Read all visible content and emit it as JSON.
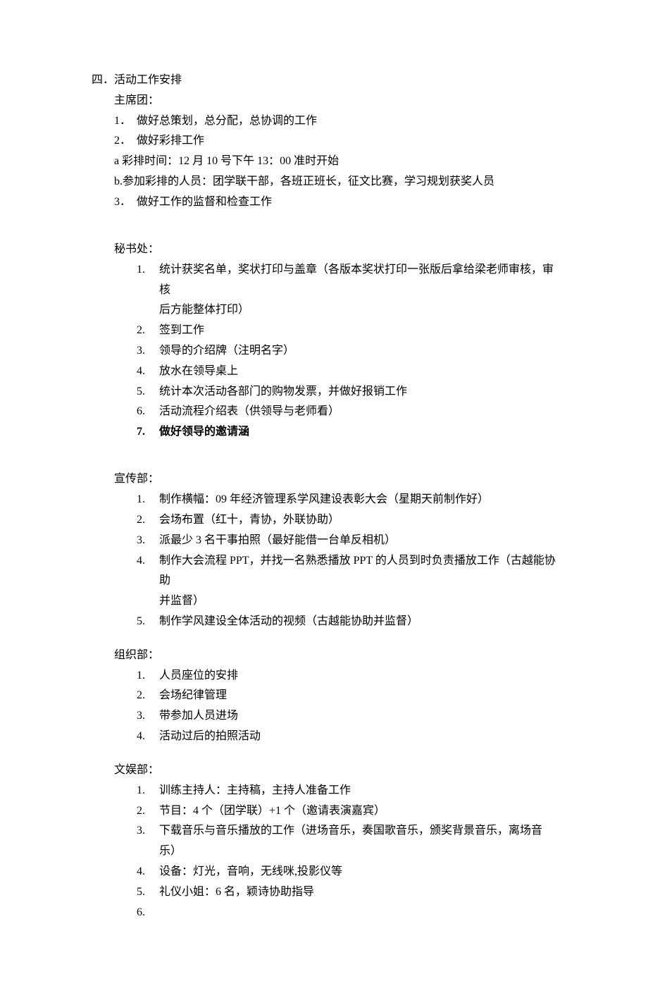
{
  "section4": {
    "title": "四．活动工作安排",
    "presidium": {
      "header": "主席团：",
      "item1_num": "1．",
      "item1": "做好总策划，总分配，总协调的工作",
      "item2_num": "2．",
      "item2": "做好彩排工作",
      "sub_a": "a 彩排时间：12 月 10 号下午 13：00 准时开始",
      "sub_b": "b.参加彩排的人员：团学联干部，各班正班长，征文比赛，学习规划获奖人员",
      "item3_num": "3．",
      "item3": "做好工作的监督和检查工作"
    },
    "secretariat": {
      "header": "秘书处：",
      "item1_num": "1.",
      "item1": "统计获奖名单，奖状打印与盖章（各版本奖状打印一张版后拿给梁老师审核，审核",
      "item1_cont": "后方能整体打印）",
      "item2_num": "2.",
      "item2": "签到工作",
      "item3_num": "3.",
      "item3": "领导的介绍牌（注明名字）",
      "item4_num": "4.",
      "item4": "放水在领导桌上",
      "item5_num": "5.",
      "item5": "统计本次活动各部门的购物发票，并做好报销工作",
      "item6_num": "6.",
      "item6": "活动流程介绍表（供领导与老师看）",
      "item7_num": "7.",
      "item7": "做好领导的邀请涵"
    },
    "publicity": {
      "header": "宣传部：",
      "item1_num": "1.",
      "item1": "制作横幅：09 年经济管理系学风建设表彰大会（星期天前制作好）",
      "item2_num": "2.",
      "item2": "会场布置（红十，青协，外联协助）",
      "item3_num": "3.",
      "item3": "派最少 3 名干事拍照（最好能借一台单反相机）",
      "item4_num": "4.",
      "item4": "制作大会流程 PPT，并找一名熟悉播放 PPT 的人员到时负责播放工作（古越能协助",
      "item4_cont": "并监督）",
      "item5_num": "5.",
      "item5": "制作学风建设全体活动的视频（古越能协助并监督）"
    },
    "organization": {
      "header": "组织部：",
      "item1_num": "1.",
      "item1": "人员座位的安排",
      "item2_num": "2.",
      "item2": "会场纪律管理",
      "item3_num": "3.",
      "item3": "带参加人员进场",
      "item4_num": "4.",
      "item4": "活动过后的拍照活动"
    },
    "entertainment": {
      "header": "文娱部：",
      "item1_num": "1.",
      "item1": "训练主持人：主持稿，主持人准备工作",
      "item2_num": "2.",
      "item2": "节目：4 个（团学联）+1 个（邀请表演嘉宾）",
      "item3_num": "3.",
      "item3": "下载音乐与音乐播放的工作（进场音乐，奏国歌音乐，颁奖背景音乐，离场音乐）",
      "item4_num": "4.",
      "item4": "设备：灯光，音响，无线咪,投影仪等",
      "item5_num": "5.",
      "item5": "礼仪小姐：6 名，颖诗协助指导",
      "item6_num": "6."
    }
  }
}
